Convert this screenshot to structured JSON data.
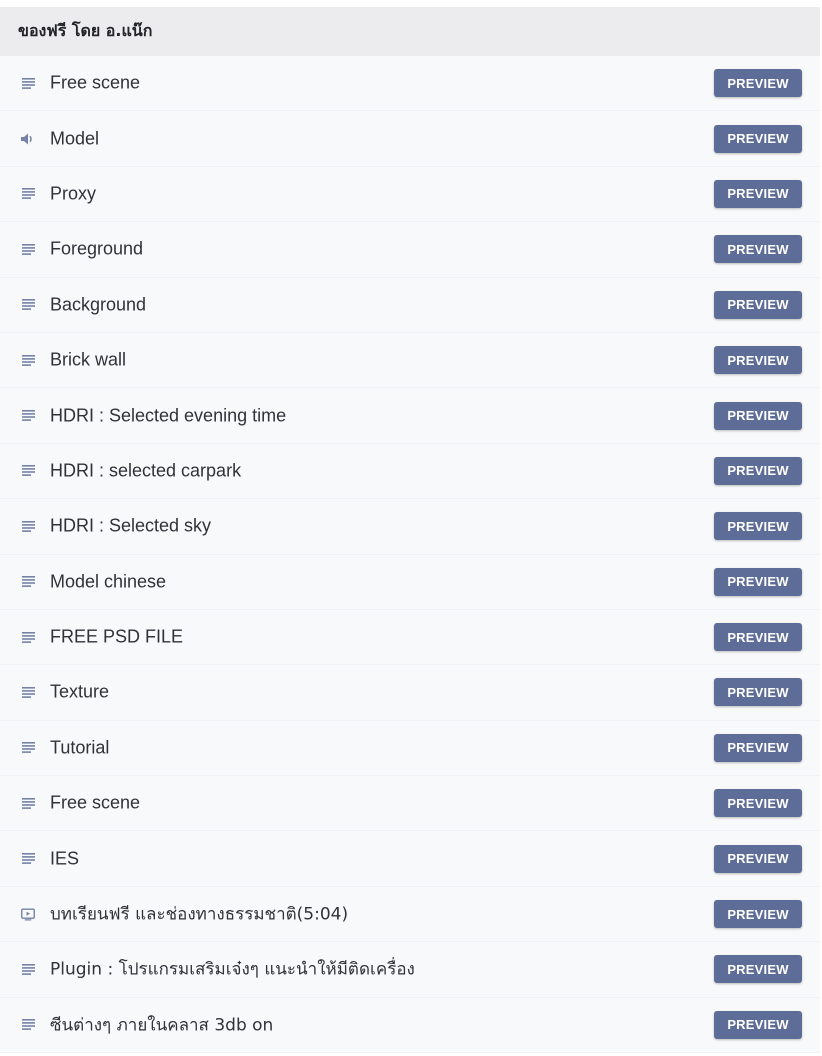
{
  "section": {
    "title": "ของฟรี โดย อ.แน๊ก"
  },
  "colors": {
    "button_bg": "#5e6d98",
    "icon": "#7582a6",
    "header_bg": "#ececef"
  },
  "lessons": [
    {
      "title": "Free scene",
      "icon": "text-lines-icon",
      "button": "PREVIEW"
    },
    {
      "title": "Model",
      "icon": "audio-icon",
      "button": "PREVIEW"
    },
    {
      "title": "Proxy",
      "icon": "text-lines-icon",
      "button": "PREVIEW"
    },
    {
      "title": "Foreground",
      "icon": "text-lines-icon",
      "button": "PREVIEW"
    },
    {
      "title": "Background",
      "icon": "text-lines-icon",
      "button": "PREVIEW"
    },
    {
      "title": "Brick wall",
      "icon": "text-lines-icon",
      "button": "PREVIEW"
    },
    {
      "title": "HDRI : Selected evening time",
      "icon": "text-lines-icon",
      "button": "PREVIEW"
    },
    {
      "title": "HDRI : selected carpark",
      "icon": "text-lines-icon",
      "button": "PREVIEW"
    },
    {
      "title": "HDRI : Selected sky",
      "icon": "text-lines-icon",
      "button": "PREVIEW"
    },
    {
      "title": "Model chinese",
      "icon": "text-lines-icon",
      "button": "PREVIEW"
    },
    {
      "title": "FREE PSD FILE",
      "icon": "text-lines-icon",
      "button": "PREVIEW"
    },
    {
      "title": "Texture",
      "icon": "text-lines-icon",
      "button": "PREVIEW"
    },
    {
      "title": "Tutorial",
      "icon": "text-lines-icon",
      "button": "PREVIEW"
    },
    {
      "title": "Free scene",
      "icon": "text-lines-icon",
      "button": "PREVIEW"
    },
    {
      "title": "IES",
      "icon": "text-lines-icon",
      "button": "PREVIEW"
    },
    {
      "title": "บทเรียนฟรี และช่องทางธรรมชาติ(5:04)",
      "icon": "video-play-icon",
      "button": "PREVIEW"
    },
    {
      "title": "Plugin : โปรแกรมเสริมเจ๋งๆ แนะนำให้มีติดเครื่อง",
      "icon": "text-lines-icon",
      "button": "PREVIEW"
    },
    {
      "title": "ซีนต่างๆ ภายในคลาส 3db on",
      "icon": "text-lines-icon",
      "button": "PREVIEW"
    }
  ]
}
